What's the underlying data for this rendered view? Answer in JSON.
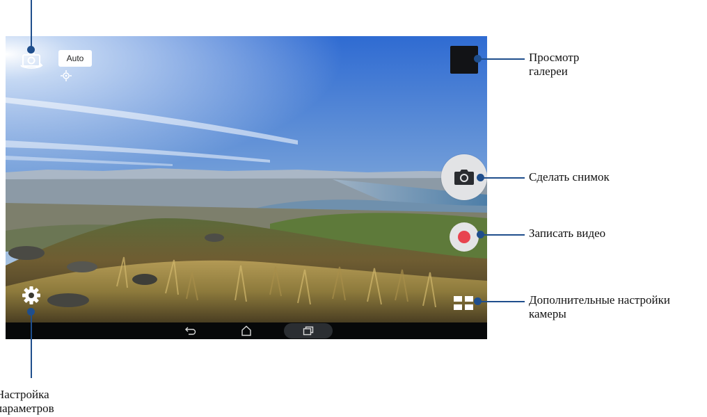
{
  "camera": {
    "mode_badge": "Auto"
  },
  "icons": {
    "switch_camera": "switch-camera-icon",
    "focus": "focus-target-icon",
    "shutter": "camera-icon",
    "record": "record-dot-icon",
    "more_settings": "grid-settings-icon",
    "settings": "gear-icon",
    "nav_back": "back-icon",
    "nav_home": "home-icon",
    "nav_recents": "recents-icon"
  },
  "callouts": {
    "gallery_line1": "Просмотр",
    "gallery_line2": "галереи",
    "shutter": "Сделать снимок",
    "record": "Записать видео",
    "advanced_line1": "Дополнительные настройки",
    "advanced_line2": "камеры",
    "settings_line1": "Настройка",
    "settings_line2": "параметров"
  },
  "colors": {
    "callout_line": "#1f4e8c",
    "record_red": "#e8434f",
    "shutter_bg": "#e2e3e5",
    "navbar": "#070809"
  }
}
